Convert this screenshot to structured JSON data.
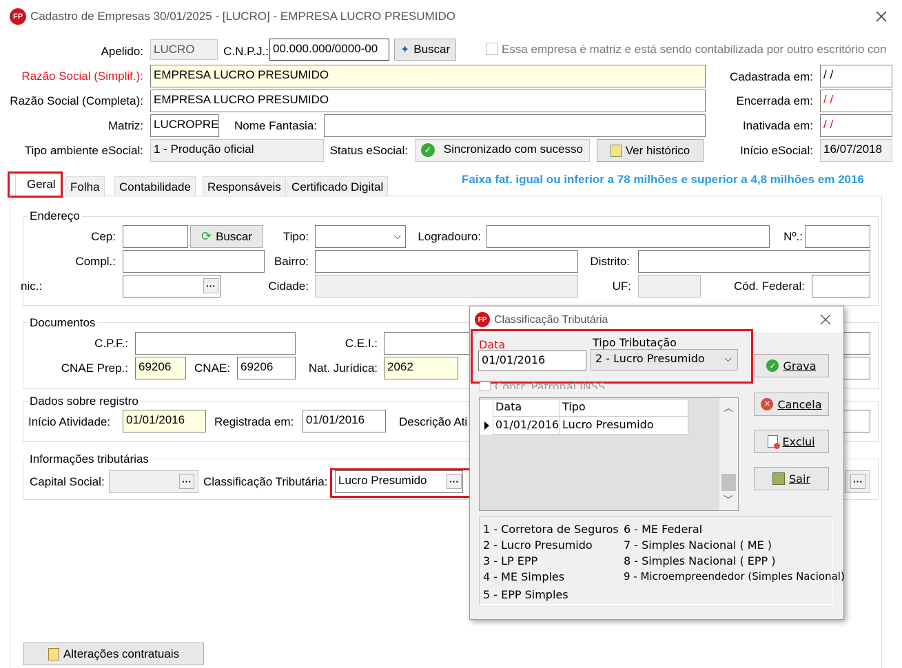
{
  "window": {
    "title": "Cadastro de Empresas  30/01/2025 - [LUCRO] - EMPRESA LUCRO PRESUMIDO",
    "app_icon_text": "FP"
  },
  "header": {
    "apelido_label": "Apelido:",
    "apelido_value": "LUCRO",
    "cnpj_label": "C.N.P.J.:",
    "cnpj_value": "00.000.000/0000-00",
    "buscar_label": "Buscar",
    "matriz_check_label": "Essa empresa é matriz e está sendo contabilizada por outro escritório con",
    "razao_simpl_label": "Razão Social (Simplif.):",
    "razao_simpl_value": "EMPRESA LUCRO PRESUMIDO",
    "razao_compl_label": "Razão Social (Completa):",
    "razao_compl_value": "EMPRESA LUCRO PRESUMIDO",
    "matriz_label": "Matriz:",
    "matriz_value": "LUCROPRE",
    "nome_fantasia_label": "Nome Fantasia:",
    "nome_fantasia_value": "",
    "tipo_amb_label": "Tipo ambiente eSocial:",
    "tipo_amb_value": "1 - Produção oficial",
    "status_label": "Status eSocial:",
    "status_value": "Sincronizado com sucesso",
    "ver_historico_label": "Ver histórico",
    "cadastrada_label": "Cadastrada em:",
    "cadastrada_value": " / /",
    "encerrada_label": "Encerrada em:",
    "encerrada_value": " / /",
    "inativada_label": "Inativada em:",
    "inativada_value": " / /",
    "inicio_esocial_label": "Início eSocial:",
    "inicio_esocial_value": "16/07/2018"
  },
  "tabs": [
    "Geral",
    "Folha",
    "Contabilidade",
    "Responsáveis",
    "Certificado Digital"
  ],
  "faixa_text": "Faixa fat. igual ou inferior a 78 milhões e superior a 4,8 milhões em 2016",
  "endereco": {
    "title": "Endereço",
    "cep_label": "Cep:",
    "buscar_label": "Buscar",
    "tipo_label": "Tipo:",
    "logradouro_label": "Logradouro:",
    "numero_label": "Nº.:",
    "compl_label": "Compl.:",
    "bairro_label": "Bairro:",
    "distrito_label": "Distrito:",
    "munic_label": "nic.:",
    "cidade_label": "Cidade:",
    "uf_label": "UF:",
    "cod_federal_label": "Cód. Federal:"
  },
  "documentos": {
    "title": "Documentos",
    "cpf_label": "C.P.F.:",
    "cei_label": "C.E.I.:",
    "cnae_prep_label": "CNAE Prep.:",
    "cnae_prep_value": "69206",
    "cnae_label": "CNAE:",
    "cnae_value": "69206",
    "nat_juridica_label": "Nat. Jurídica:",
    "nat_juridica_value": "2062"
  },
  "registro": {
    "title": "Dados sobre registro",
    "inicio_label": "Início Atividade:",
    "inicio_value": "01/01/2016",
    "registrada_label": "Registrada em:",
    "registrada_value": "01/01/2016",
    "descricao_label": "Descrição Ati"
  },
  "tributarias": {
    "title": "Informações tributárias",
    "capital_label": "Capital Social:",
    "classif_label": "Classificação Tributária:",
    "classif_value": "Lucro Presumido"
  },
  "alteracoes_label": "Alterações contratuais",
  "dialog": {
    "title": "Classificação Tributária",
    "data_label": "Data",
    "data_value": "01/01/2016",
    "tipo_label": "Tipo Tributação",
    "tipo_value": "2 - Lucro Presumido",
    "contr_label": "Contr. Patronal INSS",
    "grid_headers": [
      "Data",
      "Tipo"
    ],
    "grid_rows": [
      {
        "data": "01/01/2016",
        "tipo": "Lucro Presumido"
      }
    ],
    "grava_label": "Grava",
    "cancela_label": "Cancela",
    "exclui_label": "Exclui",
    "sair_label": "Sair",
    "legend_left": [
      "1 - Corretora de Seguros",
      "2 - Lucro Presumido",
      "3 - LP EPP",
      "4 - ME Simples",
      "5 - EPP Simples"
    ],
    "legend_right": [
      "6 - ME Federal",
      "7 - Simples Nacional ( ME )",
      "8 - Simples Nacional ( EPP )",
      "9 - Microempreendedor (Simples Nacional)"
    ]
  },
  "colors": {
    "red_label": "#e0141f",
    "faixa_blue": "#2a9be6",
    "yellow_field": "#ffffe1",
    "highlight_red": "#e0141f"
  }
}
